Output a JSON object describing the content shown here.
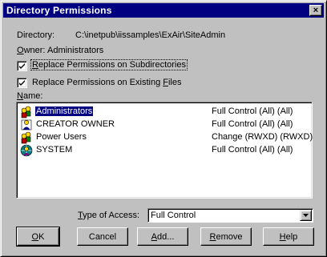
{
  "window": {
    "title": "Directory Permissions",
    "close_label": "×"
  },
  "directory": {
    "label": "Directory:",
    "path": "C:\\inetpub\\iissamples\\ExAir\\SiteAdmin"
  },
  "owner": {
    "label_rest": "wner:",
    "label_access_key": "O",
    "value": "Administrators"
  },
  "options": {
    "replace_subdirs": {
      "checked": true,
      "prefix": "",
      "access_key": "R",
      "rest": "eplace Permissions on Subdirectories"
    },
    "replace_files": {
      "checked": true,
      "prefix": "Replace Permissions on Existing ",
      "access_key": "F",
      "rest": "iles"
    }
  },
  "name_list": {
    "label_access_key": "N",
    "label_rest": "ame:",
    "rows": [
      {
        "name": "Administrators",
        "permission": "Full Control (All) (All)",
        "icon": "group-icon",
        "selected": true
      },
      {
        "name": "CREATOR OWNER",
        "permission": "Full Control (All) (All)",
        "icon": "user-icon",
        "selected": false
      },
      {
        "name": "Power Users",
        "permission": "Change (RWXD) (RWXD)",
        "icon": "group-icon",
        "selected": false
      },
      {
        "name": "SYSTEM",
        "permission": "Full Control (All) (All)",
        "icon": "system-icon",
        "selected": false
      }
    ]
  },
  "type_of_access": {
    "label_access_key": "T",
    "label_rest": "ype of Access:",
    "value": "Full Control"
  },
  "buttons": {
    "ok": {
      "prefix": "",
      "access_key": "O",
      "rest": "K"
    },
    "cancel": {
      "prefix": "",
      "access_key": "",
      "rest": "Cancel"
    },
    "add": {
      "prefix": "",
      "access_key": "A",
      "rest": "dd..."
    },
    "remove": {
      "prefix": "",
      "access_key": "R",
      "rest": "emove"
    },
    "help": {
      "prefix": "",
      "access_key": "H",
      "rest": "elp"
    }
  },
  "colors": {
    "face": "#c0c0c0",
    "titlebar": "#000080",
    "selection": "#000080"
  }
}
